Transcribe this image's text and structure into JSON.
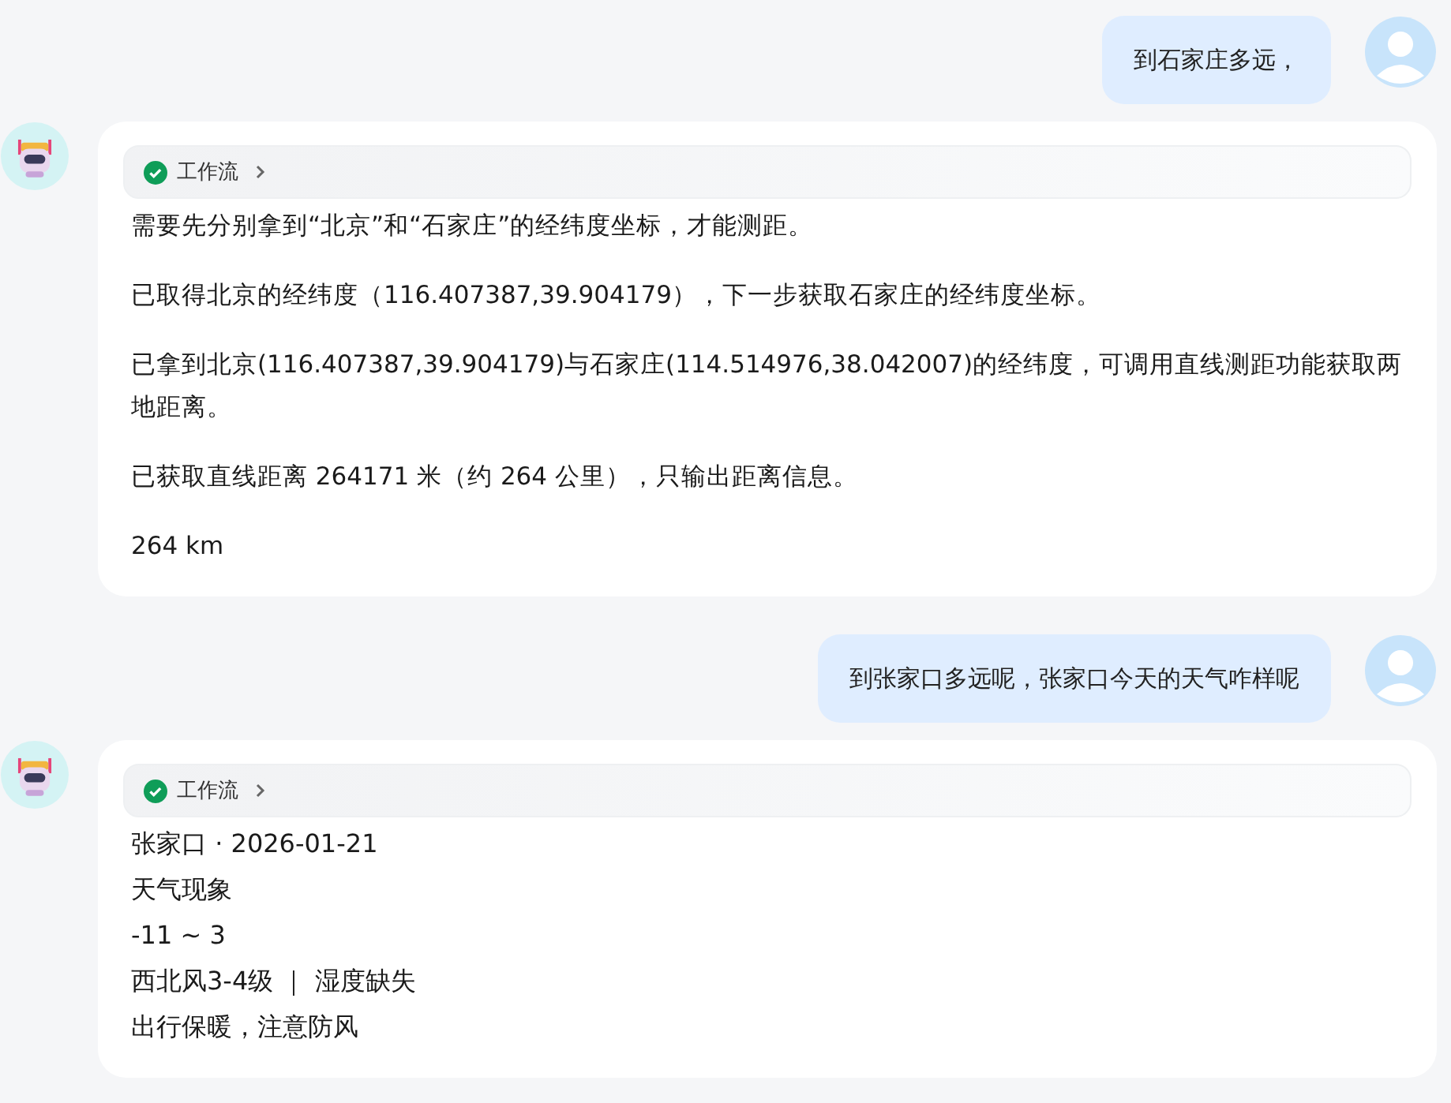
{
  "messages": [
    {
      "kind": "user",
      "text": "到石家庄多远，"
    },
    {
      "kind": "bot",
      "workflow": "工作流",
      "paragraphs": [
        "需要先分别拿到“北京”和“石家庄”的经纬度坐标，才能测距。",
        "已取得北京的经纬度（116.407387,39.904179），下一步获取石家庄的经纬度坐标。",
        "已拿到北京(116.407387,39.904179)与石家庄(114.514976,38.042007)的经纬度，可调用直线测距功能获取两地距离。",
        "已获取直线距离 264171 米（约 264 公里），只输出距离信息。",
        "264 km"
      ]
    },
    {
      "kind": "user",
      "text": "到张家口多远呢，张家口今天的天气咋样呢"
    },
    {
      "kind": "bot",
      "workflow": "工作流",
      "lines": [
        "张家口 · 2026-01-21",
        "天气现象",
        "-11 ~ 3",
        "西北风3-4级 ｜ 湿度缺失",
        "出行保暖，注意防风"
      ]
    }
  ]
}
